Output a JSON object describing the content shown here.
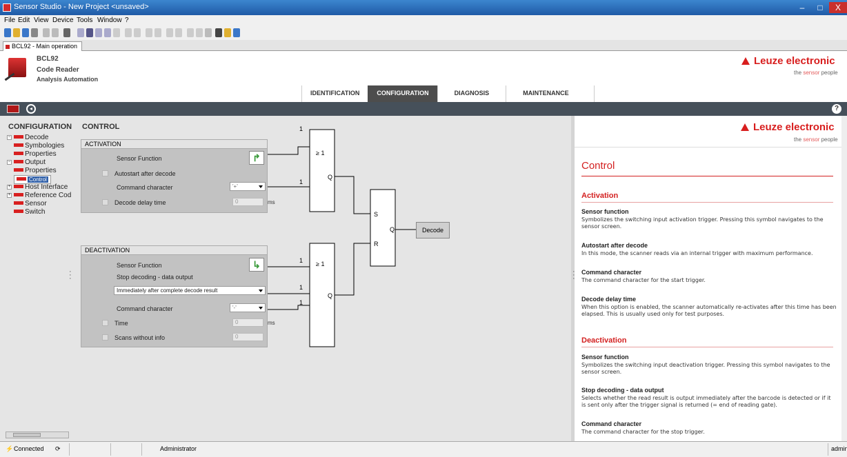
{
  "window": {
    "title": "Sensor Studio - New Project <unsaved>",
    "minimize": "–",
    "maximize": "□",
    "close": "X"
  },
  "menu": [
    "File",
    "Edit",
    "View",
    "Device",
    "Tools",
    "Window",
    "?"
  ],
  "doc_tab": "BCL92 - Main operation",
  "device": {
    "name": "BCL92",
    "type": "Code Reader",
    "category": "Analysis Automation"
  },
  "brand": {
    "name": "Leuze electronic",
    "tagline_pre": "the ",
    "tagline_hl": "sensor",
    "tagline_post": " people",
    "color": "#d81e1e"
  },
  "nav_tabs": [
    "IDENTIFICATION",
    "CONFIGURATION",
    "DIAGNOSIS",
    "MAINTENANCE"
  ],
  "nav_active": "CONFIGURATION",
  "help_icon": "?",
  "tree": {
    "title": "CONFIGURATION",
    "items": [
      "Decode",
      "Symbologies",
      "Properties",
      "Output",
      "Properties",
      "Control",
      "Host Interface",
      "Reference Cod",
      "Sensor",
      "Switch"
    ],
    "selected": "Control"
  },
  "control": {
    "title": "CONTROL",
    "activation": {
      "header": "ACTIVATION",
      "sensor_function": "Sensor Function",
      "autostart": "Autostart after decode",
      "command_character": "Command character",
      "command_value": "'+'",
      "delay": "Decode delay time",
      "delay_value": "0",
      "unit": "ms"
    },
    "deactivation": {
      "header": "DEACTIVATION",
      "sensor_function": "Sensor Function",
      "stop_decoding": "Stop decoding - data output",
      "stop_option": "Immediately after complete decode result",
      "command_character": "Command character",
      "command_value": "'-'",
      "time": "Time",
      "time_value": "0",
      "unit": "ms",
      "scans": "Scans without info",
      "scans_value": "0"
    },
    "logic": {
      "one": "1",
      "or": "≥ 1",
      "q": "Q",
      "s": "S",
      "r": "R"
    },
    "decode_button": "Decode"
  },
  "help": {
    "title": "Control",
    "activation_heading": "Activation",
    "activation_items": [
      {
        "h": "Sensor function",
        "t": "Symbolizes the switching input activation trigger. Pressing this symbol navigates to the sensor screen."
      },
      {
        "h": "Autostart after decode",
        "t": "In this mode, the scanner reads via an internal trigger with maximum performance."
      },
      {
        "h": "Command character",
        "t": "The command character for the start trigger."
      },
      {
        "h": "Decode delay time",
        "t": "When this option is enabled, the scanner automatically re-activates after this time has been elapsed. This is usually used only for test purposes."
      }
    ],
    "deactivation_heading": "Deactivation",
    "deactivation_items": [
      {
        "h": "Sensor function",
        "t": "Symbolizes the switching input deactivation trigger. Pressing this symbol navigates to the sensor screen."
      },
      {
        "h": "Stop decoding - data output",
        "t": "Selects whether the read result is output immediately after the barcode is detected or if it is sent only after the trigger signal is returned (= end of reading gate)."
      },
      {
        "h": "Command character",
        "t": "The command character for the stop trigger."
      }
    ]
  },
  "status": {
    "connection": "Connected",
    "user": "Administrator",
    "right": "admin"
  }
}
